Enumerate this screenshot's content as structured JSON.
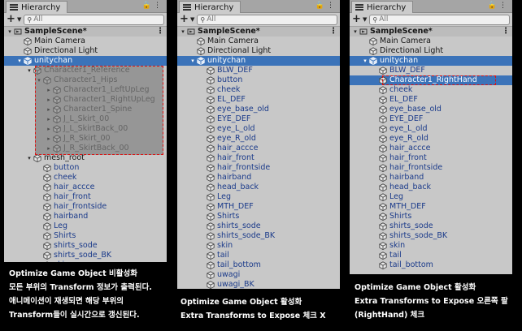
{
  "window_tab": "Hierarchy",
  "search_placeholder": "All",
  "panels": [
    {
      "id": "p1",
      "rows": [
        {
          "depth": 0,
          "arrow": "▾",
          "icon": "scene",
          "label": "SampleScene*",
          "style": "scene",
          "menu": "⋮"
        },
        {
          "depth": 1,
          "arrow": "",
          "icon": "cube",
          "label": "Main Camera"
        },
        {
          "depth": 1,
          "arrow": "",
          "icon": "cube",
          "label": "Directional Light"
        },
        {
          "depth": 1,
          "arrow": "▾",
          "icon": "prefab",
          "label": "unitychan",
          "style": "sel"
        },
        {
          "depth": 2,
          "arrow": "▾",
          "icon": "cube",
          "label": "Character1_Reference",
          "style": "faded"
        },
        {
          "depth": 3,
          "arrow": "▾",
          "icon": "cube",
          "label": "Character1_Hips",
          "style": "faded"
        },
        {
          "depth": 4,
          "arrow": "▸",
          "icon": "cube",
          "label": "Character1_LeftUpLeg",
          "style": "faded"
        },
        {
          "depth": 4,
          "arrow": "▸",
          "icon": "cube",
          "label": "Character1_RightUpLeg",
          "style": "faded"
        },
        {
          "depth": 4,
          "arrow": "▸",
          "icon": "cube",
          "label": "Character1_Spine",
          "style": "faded"
        },
        {
          "depth": 4,
          "arrow": "▸",
          "icon": "cube",
          "label": "J_L_Skirt_00",
          "style": "faded"
        },
        {
          "depth": 4,
          "arrow": "▸",
          "icon": "cube",
          "label": "J_L_SkirtBack_00",
          "style": "faded"
        },
        {
          "depth": 4,
          "arrow": "▸",
          "icon": "cube",
          "label": "J_R_Skirt_00",
          "style": "faded"
        },
        {
          "depth": 4,
          "arrow": "▸",
          "icon": "cube",
          "label": "J_R_SkirtBack_00",
          "style": "faded"
        },
        {
          "depth": 2,
          "arrow": "▾",
          "icon": "cube",
          "label": "mesh_root"
        },
        {
          "depth": 3,
          "arrow": "",
          "icon": "cube",
          "label": "button",
          "style": "blue"
        },
        {
          "depth": 3,
          "arrow": "",
          "icon": "cube",
          "label": "cheek",
          "style": "blue"
        },
        {
          "depth": 3,
          "arrow": "",
          "icon": "cube",
          "label": "hair_accce",
          "style": "blue"
        },
        {
          "depth": 3,
          "arrow": "",
          "icon": "cube",
          "label": "hair_front",
          "style": "blue"
        },
        {
          "depth": 3,
          "arrow": "",
          "icon": "cube",
          "label": "hair_frontside",
          "style": "blue"
        },
        {
          "depth": 3,
          "arrow": "",
          "icon": "cube",
          "label": "hairband",
          "style": "blue"
        },
        {
          "depth": 3,
          "arrow": "",
          "icon": "cube",
          "label": "Leg",
          "style": "blue"
        },
        {
          "depth": 3,
          "arrow": "",
          "icon": "cube",
          "label": "Shirts",
          "style": "blue"
        },
        {
          "depth": 3,
          "arrow": "",
          "icon": "cube",
          "label": "shirts_sode",
          "style": "blue"
        },
        {
          "depth": 3,
          "arrow": "",
          "icon": "cube",
          "label": "shirts_sode_BK",
          "style": "blue"
        },
        {
          "depth": 3,
          "arrow": "",
          "icon": "cube",
          "label": "skin",
          "style": "blue"
        }
      ],
      "captions": [
        "Optimize Game Object 비활성화",
        "모든 부위의 Transform 정보가 출력된다.",
        "애니메이션이 재생되면 해당 부위의",
        "Transform들이 실시간으로 갱신된다."
      ]
    },
    {
      "id": "p2",
      "rows": [
        {
          "depth": 0,
          "arrow": "▾",
          "icon": "scene",
          "label": "SampleScene*",
          "style": "scene",
          "menu": "⋮"
        },
        {
          "depth": 1,
          "arrow": "",
          "icon": "cube",
          "label": "Main Camera"
        },
        {
          "depth": 1,
          "arrow": "",
          "icon": "cube",
          "label": "Directional Light"
        },
        {
          "depth": 1,
          "arrow": "▾",
          "icon": "prefab",
          "label": "unitychan",
          "style": "sel"
        },
        {
          "depth": 2,
          "arrow": "",
          "icon": "cube",
          "label": "BLW_DEF",
          "style": "blue"
        },
        {
          "depth": 2,
          "arrow": "",
          "icon": "cube",
          "label": "button",
          "style": "blue"
        },
        {
          "depth": 2,
          "arrow": "",
          "icon": "cube",
          "label": "cheek",
          "style": "blue"
        },
        {
          "depth": 2,
          "arrow": "",
          "icon": "cube",
          "label": "EL_DEF",
          "style": "blue"
        },
        {
          "depth": 2,
          "arrow": "",
          "icon": "cube",
          "label": "eye_base_old",
          "style": "blue"
        },
        {
          "depth": 2,
          "arrow": "",
          "icon": "cube",
          "label": "EYE_DEF",
          "style": "blue"
        },
        {
          "depth": 2,
          "arrow": "",
          "icon": "cube",
          "label": "eye_L_old",
          "style": "blue"
        },
        {
          "depth": 2,
          "arrow": "",
          "icon": "cube",
          "label": "eye_R_old",
          "style": "blue"
        },
        {
          "depth": 2,
          "arrow": "",
          "icon": "cube",
          "label": "hair_accce",
          "style": "blue"
        },
        {
          "depth": 2,
          "arrow": "",
          "icon": "cube",
          "label": "hair_front",
          "style": "blue"
        },
        {
          "depth": 2,
          "arrow": "",
          "icon": "cube",
          "label": "hair_frontside",
          "style": "blue"
        },
        {
          "depth": 2,
          "arrow": "",
          "icon": "cube",
          "label": "hairband",
          "style": "blue"
        },
        {
          "depth": 2,
          "arrow": "",
          "icon": "cube",
          "label": "head_back",
          "style": "blue"
        },
        {
          "depth": 2,
          "arrow": "",
          "icon": "cube",
          "label": "Leg",
          "style": "blue"
        },
        {
          "depth": 2,
          "arrow": "",
          "icon": "cube",
          "label": "MTH_DEF",
          "style": "blue"
        },
        {
          "depth": 2,
          "arrow": "",
          "icon": "cube",
          "label": "Shirts",
          "style": "blue"
        },
        {
          "depth": 2,
          "arrow": "",
          "icon": "cube",
          "label": "shirts_sode",
          "style": "blue"
        },
        {
          "depth": 2,
          "arrow": "",
          "icon": "cube",
          "label": "shirts_sode_BK",
          "style": "blue"
        },
        {
          "depth": 2,
          "arrow": "",
          "icon": "cube",
          "label": "skin",
          "style": "blue"
        },
        {
          "depth": 2,
          "arrow": "",
          "icon": "cube",
          "label": "tail",
          "style": "blue"
        },
        {
          "depth": 2,
          "arrow": "",
          "icon": "cube",
          "label": "tail_bottom",
          "style": "blue"
        },
        {
          "depth": 2,
          "arrow": "",
          "icon": "cube",
          "label": "uwagi",
          "style": "blue"
        },
        {
          "depth": 2,
          "arrow": "",
          "icon": "cube",
          "label": "uwagi_BK",
          "style": "blue"
        }
      ],
      "captions": [
        "Optimize Game Object 활성화",
        "Extra Transforms to Expose 체크 X"
      ]
    },
    {
      "id": "p3",
      "rows": [
        {
          "depth": 0,
          "arrow": "▾",
          "icon": "scene",
          "label": "SampleScene*",
          "style": "scene",
          "menu": "⋮"
        },
        {
          "depth": 1,
          "arrow": "",
          "icon": "cube",
          "label": "Main Camera"
        },
        {
          "depth": 1,
          "arrow": "",
          "icon": "cube",
          "label": "Directional Light"
        },
        {
          "depth": 1,
          "arrow": "▾",
          "icon": "prefab",
          "label": "unitychan",
          "style": "sel"
        },
        {
          "depth": 2,
          "arrow": "",
          "icon": "cube",
          "label": "BLW_DEF",
          "style": "blue"
        },
        {
          "depth": 2,
          "arrow": "",
          "icon": "cube",
          "label": "Character1_RightHand",
          "style": "sel"
        },
        {
          "depth": 2,
          "arrow": "",
          "icon": "cube",
          "label": "cheek",
          "style": "blue"
        },
        {
          "depth": 2,
          "arrow": "",
          "icon": "cube",
          "label": "EL_DEF",
          "style": "blue"
        },
        {
          "depth": 2,
          "arrow": "",
          "icon": "cube",
          "label": "eye_base_old",
          "style": "blue"
        },
        {
          "depth": 2,
          "arrow": "",
          "icon": "cube",
          "label": "EYE_DEF",
          "style": "blue"
        },
        {
          "depth": 2,
          "arrow": "",
          "icon": "cube",
          "label": "eye_L_old",
          "style": "blue"
        },
        {
          "depth": 2,
          "arrow": "",
          "icon": "cube",
          "label": "eye_R_old",
          "style": "blue"
        },
        {
          "depth": 2,
          "arrow": "",
          "icon": "cube",
          "label": "hair_accce",
          "style": "blue"
        },
        {
          "depth": 2,
          "arrow": "",
          "icon": "cube",
          "label": "hair_front",
          "style": "blue"
        },
        {
          "depth": 2,
          "arrow": "",
          "icon": "cube",
          "label": "hair_frontside",
          "style": "blue"
        },
        {
          "depth": 2,
          "arrow": "",
          "icon": "cube",
          "label": "hairband",
          "style": "blue"
        },
        {
          "depth": 2,
          "arrow": "",
          "icon": "cube",
          "label": "head_back",
          "style": "blue"
        },
        {
          "depth": 2,
          "arrow": "",
          "icon": "cube",
          "label": "Leg",
          "style": "blue"
        },
        {
          "depth": 2,
          "arrow": "",
          "icon": "cube",
          "label": "MTH_DEF",
          "style": "blue"
        },
        {
          "depth": 2,
          "arrow": "",
          "icon": "cube",
          "label": "Shirts",
          "style": "blue"
        },
        {
          "depth": 2,
          "arrow": "",
          "icon": "cube",
          "label": "shirts_sode",
          "style": "blue"
        },
        {
          "depth": 2,
          "arrow": "",
          "icon": "cube",
          "label": "shirts_sode_BK",
          "style": "blue"
        },
        {
          "depth": 2,
          "arrow": "",
          "icon": "cube",
          "label": "skin",
          "style": "blue"
        },
        {
          "depth": 2,
          "arrow": "",
          "icon": "cube",
          "label": "tail",
          "style": "blue"
        },
        {
          "depth": 2,
          "arrow": "",
          "icon": "cube",
          "label": "tail_bottom",
          "style": "blue"
        }
      ],
      "captions": [
        "Optimize Game Object 활성화",
        "Extra Transforms to Expose 오른쪽 팔",
        "(RightHand) 체크"
      ]
    }
  ],
  "colors": {
    "selection": "#3b73b9",
    "highlight_border": "#dd1111",
    "object_text": "#1a3a8a"
  }
}
